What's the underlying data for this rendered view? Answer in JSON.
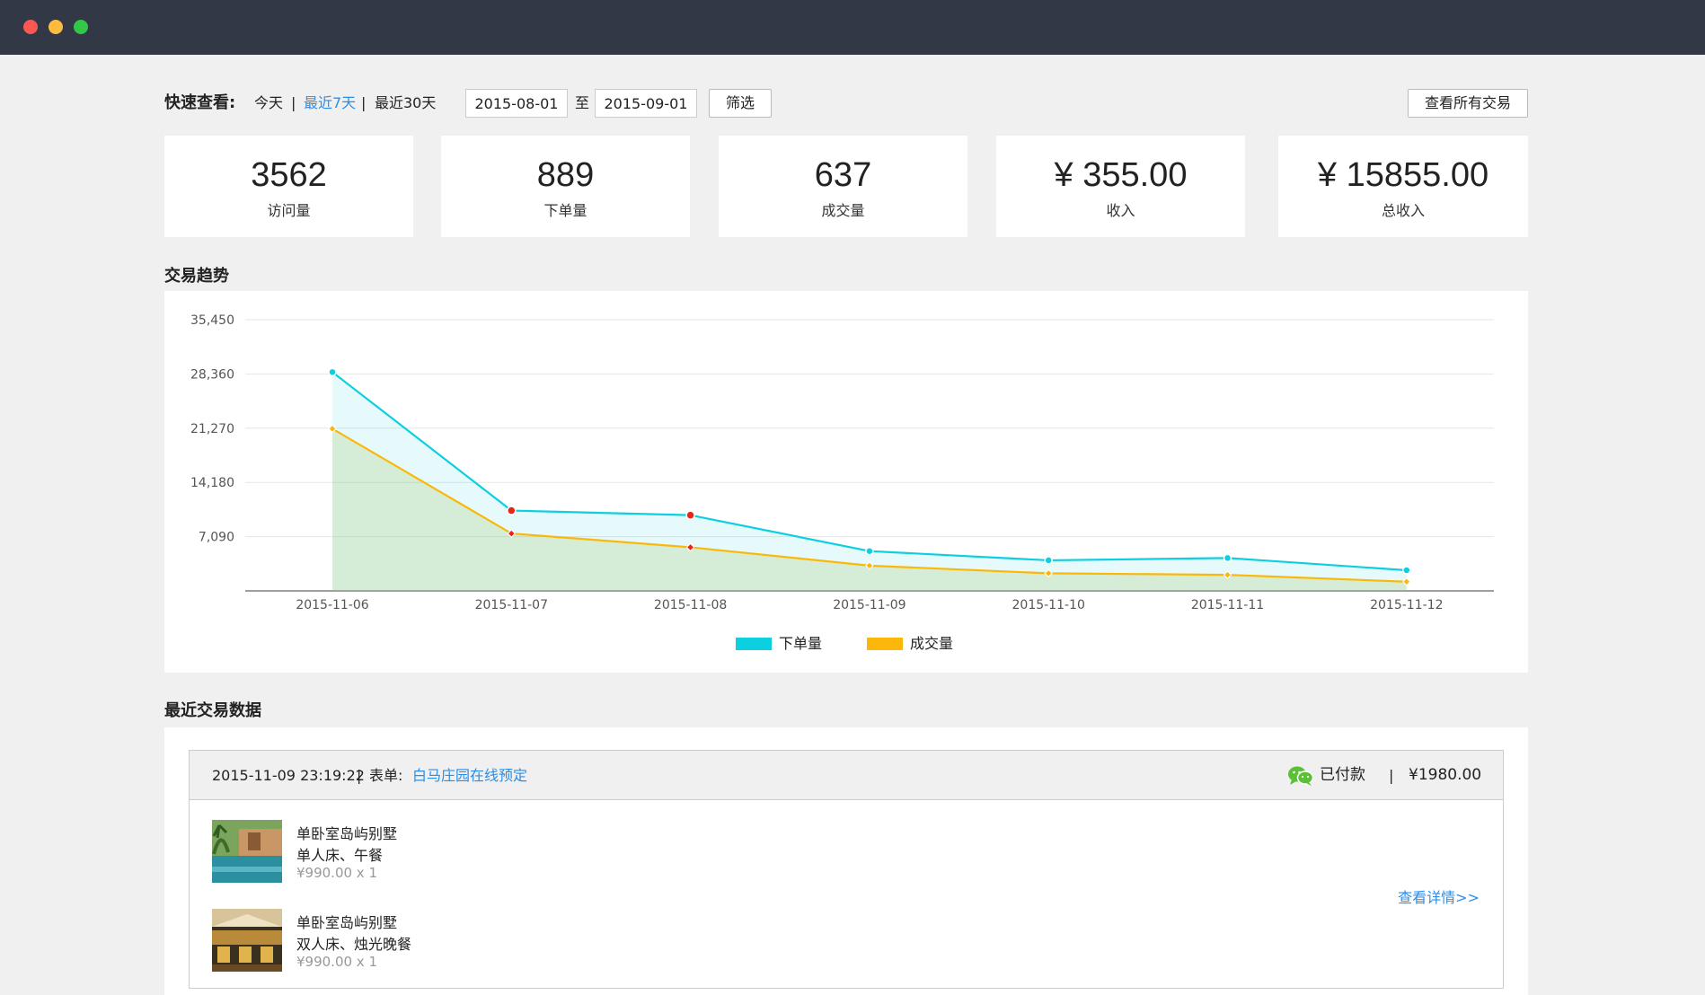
{
  "window": {
    "buttons": [
      "close",
      "minimize",
      "maximize"
    ]
  },
  "filter": {
    "quick_label": "快速查看:",
    "options": [
      "今天",
      "最近7天",
      "最近30天"
    ],
    "active_option": "最近7天",
    "separator": "|",
    "start_date": "2015-08-01",
    "to_label": "至",
    "end_date": "2015-09-01",
    "filter_button": "筛选",
    "all_transactions_button": "查看所有交易"
  },
  "stats": [
    {
      "value": "3562",
      "label": "访问量"
    },
    {
      "value": "889",
      "label": "下单量"
    },
    {
      "value": "637",
      "label": "成交量"
    },
    {
      "value": "¥ 355.00",
      "label": "收入"
    },
    {
      "value": "¥ 15855.00",
      "label": "总收入"
    }
  ],
  "trend": {
    "title": "交易趋势"
  },
  "chart_data": {
    "type": "area",
    "x": [
      "2015-11-06",
      "2015-11-07",
      "2015-11-08",
      "2015-11-09",
      "2015-11-10",
      "2015-11-11",
      "2015-11-12"
    ],
    "y_ticks": [
      "35,450",
      "28,360",
      "21,270",
      "14,180",
      "7,090"
    ],
    "ylim": [
      0,
      35450
    ],
    "grid": true,
    "legend_position": "bottom-center",
    "series": [
      {
        "name": "下单量",
        "color": "#0ccfe0",
        "values": [
          28600,
          10500,
          9900,
          5200,
          4000,
          4300,
          2700
        ]
      },
      {
        "name": "成交量",
        "color": "#fbb80a",
        "values": [
          21200,
          7500,
          5700,
          3300,
          2300,
          2100,
          1200
        ]
      }
    ],
    "highlight_color": "#e8251b",
    "highlighted_points": [
      1,
      2
    ]
  },
  "recent": {
    "title": "最近交易数据",
    "order": {
      "time": "2015-11-09 23:19:22",
      "form_label": "表单:",
      "form_name": "白马庄园在线预定",
      "pay_icon": "wechat-icon",
      "status": "已付款",
      "amount": "¥1980.00",
      "items": [
        {
          "name": "单卧室岛屿别墅",
          "desc": "单人床、午餐",
          "price": "¥990.00 x 1"
        },
        {
          "name": "单卧室岛屿别墅",
          "desc": "双人床、烛光晚餐",
          "price": "¥990.00 x 1"
        }
      ],
      "detail_link": "查看详情>>"
    }
  }
}
